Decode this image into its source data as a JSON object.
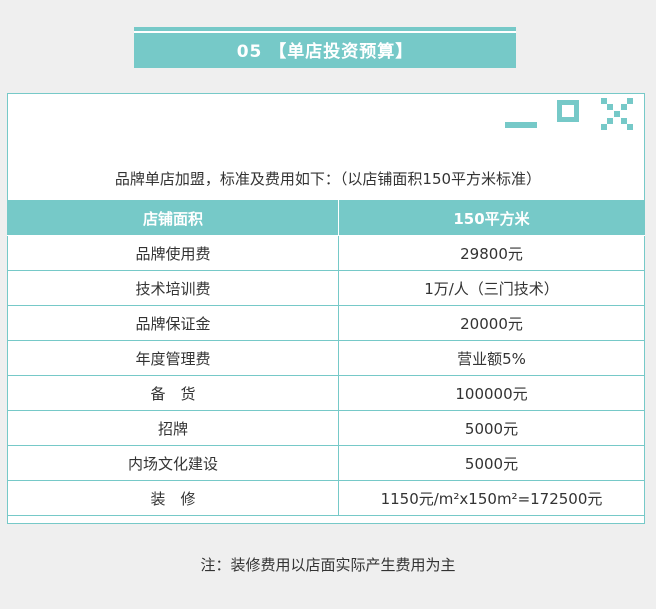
{
  "title": "05 【单店投资预算】",
  "intro": "品牌单店加盟，标准及费用如下：（以店铺面积150平方米标准）",
  "table": {
    "headers": [
      "店铺面积",
      "150平方米"
    ],
    "rows": [
      [
        "品牌使用费",
        "29800元"
      ],
      [
        "技术培训费",
        "1万/人（三门技术）"
      ],
      [
        "品牌保证金",
        "20000元"
      ],
      [
        "年度管理费",
        "营业额5%"
      ],
      [
        "备　货",
        "100000元"
      ],
      [
        "招牌",
        "5000元"
      ],
      [
        "内场文化建设",
        "5000元"
      ],
      [
        "装　修",
        "1150元/m²x150m²=172500元"
      ]
    ]
  },
  "note": "注：装修费用以店面实际产生费用为主",
  "colors": {
    "accent": "#76c9c8",
    "background": "#efefef"
  },
  "icons": [
    "minimize-icon",
    "maximize-icon",
    "close-icon"
  ]
}
